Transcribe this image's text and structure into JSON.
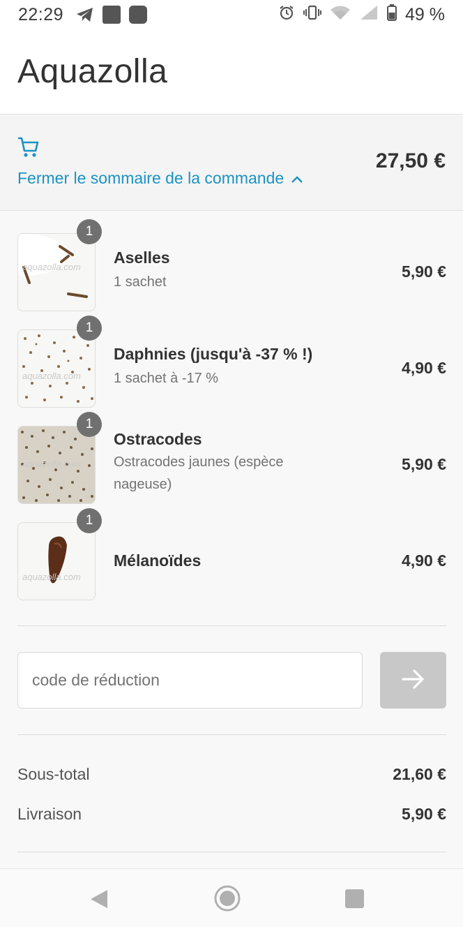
{
  "status_bar": {
    "time": "22:29",
    "battery": "49 %",
    "icons_left": [
      "telegram-icon",
      "notification-square-icon",
      "notification-rounded-icon"
    ],
    "icons_right": [
      "alarm-icon",
      "vibrate-icon",
      "wifi-icon",
      "signal-icon",
      "battery-icon"
    ]
  },
  "header": {
    "title": "Aquazolla"
  },
  "order_summary": {
    "toggle_label": "Fermer le sommaire de la commande",
    "total": "27,50 €",
    "accent_color": "#1b93c4"
  },
  "items": [
    {
      "quantity": "1",
      "name": "Aselles",
      "variant": "1 sachet",
      "price": "5,90 €",
      "watermark": "aquazolla.com"
    },
    {
      "quantity": "1",
      "name": "Daphnies (jusqu'à -37 % !)",
      "variant": "1 sachet à -17 %",
      "price": "4,90 €",
      "watermark": "aquazolla.com"
    },
    {
      "quantity": "1",
      "name": "Ostracodes",
      "variant": "Ostracodes jaunes (espèce nageuse)",
      "price": "5,90 €",
      "watermark": "aquazolla.com"
    },
    {
      "quantity": "1",
      "name": "Mélanoïdes",
      "variant": "",
      "price": "4,90 €",
      "watermark": "aquazolla.com"
    }
  ],
  "discount": {
    "placeholder": "code de réduction",
    "value": ""
  },
  "totals": {
    "subtotal_label": "Sous-total",
    "subtotal_value": "21,60 €",
    "shipping_label": "Livraison",
    "shipping_value": "5,90 €"
  }
}
